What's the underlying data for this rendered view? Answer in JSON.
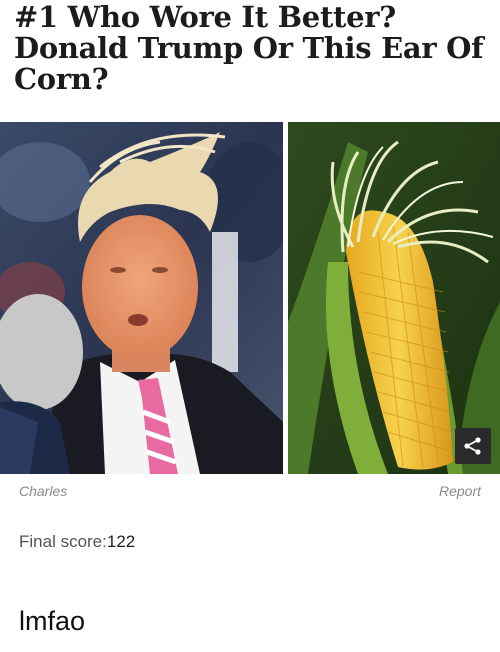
{
  "post": {
    "headline": "#1 Who Wore It Better? Donald Trump Or This Ear Of Corn?"
  },
  "meta": {
    "username": "Charles",
    "report_label": "Report"
  },
  "score": {
    "label": "Final score:",
    "value": "122"
  },
  "caption": {
    "text": "lmfao"
  },
  "icons": {
    "share": "share-icon"
  }
}
